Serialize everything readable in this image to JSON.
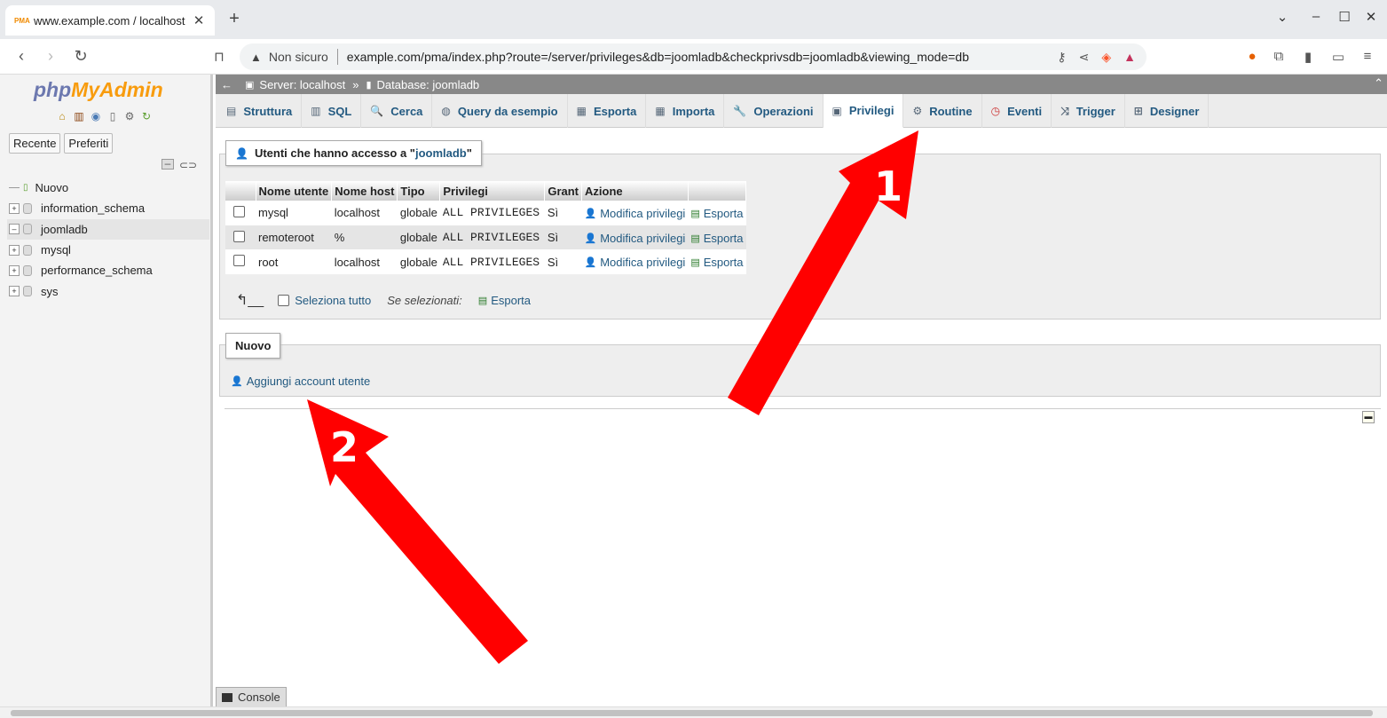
{
  "browser": {
    "tab_title": "www.example.com / localhost",
    "favicon": "PMA",
    "url_warning": "Non sicuro",
    "url": "example.com/pma/index.php?route=/server/privileges&db=joomladb&checkprivsdb=joomladb&viewing_mode=db"
  },
  "sidebar": {
    "logo_php": "php",
    "logo_myadmin": "MyAdmin",
    "btn_recent": "Recente",
    "btn_favorites": "Preferiti",
    "tree": [
      {
        "label": "Nuovo"
      },
      {
        "label": "information_schema"
      },
      {
        "label": "joomladb"
      },
      {
        "label": "mysql"
      },
      {
        "label": "performance_schema"
      },
      {
        "label": "sys"
      }
    ]
  },
  "breadcrumb": {
    "server": "Server: localhost",
    "sep": "»",
    "database": "Database: joomladb"
  },
  "tabs": [
    {
      "label": "Struttura",
      "icon": "▤"
    },
    {
      "label": "SQL",
      "icon": "▥"
    },
    {
      "label": "Cerca",
      "icon": "🔍"
    },
    {
      "label": "Query da esempio",
      "icon": "◍"
    },
    {
      "label": "Esporta",
      "icon": "▦"
    },
    {
      "label": "Importa",
      "icon": "▦"
    },
    {
      "label": "Operazioni",
      "icon": "🔧"
    },
    {
      "label": "Privilegi",
      "icon": "▣"
    },
    {
      "label": "Routine",
      "icon": "⚙"
    },
    {
      "label": "Eventi",
      "icon": "◷"
    },
    {
      "label": "Trigger",
      "icon": "⤨"
    },
    {
      "label": "Designer",
      "icon": "⊞"
    }
  ],
  "users_panel": {
    "legend_prefix": "Utenti che hanno accesso a \"",
    "legend_db": "joomladb",
    "legend_suffix": "\"",
    "headers": [
      "Nome utente",
      "Nome host",
      "Tipo",
      "Privilegi",
      "Grant",
      "Azione"
    ],
    "rows": [
      {
        "user": "mysql",
        "host": "localhost",
        "type": "globale",
        "priv": "ALL PRIVILEGES",
        "grant": "Sì",
        "edit": "Modifica privilegi",
        "export": "Esporta"
      },
      {
        "user": "remoteroot",
        "host": "%",
        "type": "globale",
        "priv": "ALL PRIVILEGES",
        "grant": "Sì",
        "edit": "Modifica privilegi",
        "export": "Esporta"
      },
      {
        "user": "root",
        "host": "localhost",
        "type": "globale",
        "priv": "ALL PRIVILEGES",
        "grant": "Sì",
        "edit": "Modifica privilegi",
        "export": "Esporta"
      }
    ],
    "select_all": "Seleziona tutto",
    "if_selected": "Se selezionati:",
    "export_selected": "Esporta"
  },
  "new_panel": {
    "legend": "Nuovo",
    "add_user": "Aggiungi account utente"
  },
  "console": "Console",
  "annotations": {
    "label_1": "1",
    "label_2": "2",
    "color": "#ff0000"
  }
}
